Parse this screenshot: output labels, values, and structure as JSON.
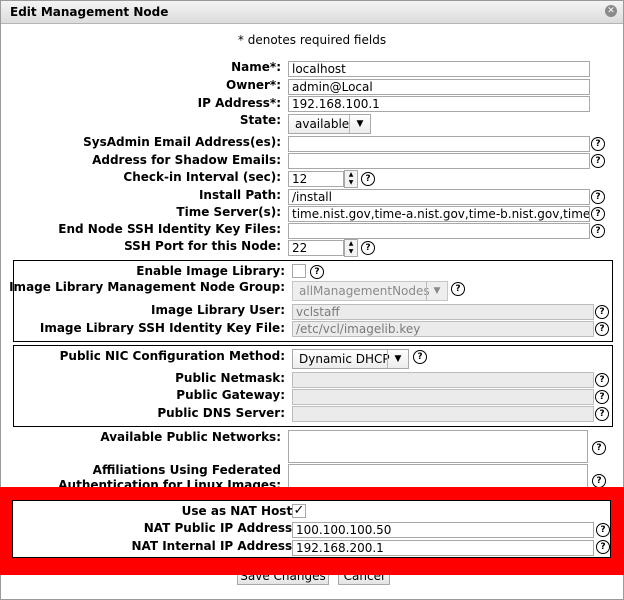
{
  "dialog": {
    "title": "Edit Management Node",
    "required_note": "* denotes required fields"
  },
  "fields": {
    "name": {
      "label": "Name*:",
      "value": "localhost"
    },
    "owner": {
      "label": "Owner*:",
      "value": "admin@Local"
    },
    "ip": {
      "label": "IP Address*:",
      "value": "192.168.100.1"
    },
    "state": {
      "label": "State:",
      "value": "available"
    },
    "sysadmin_email": {
      "label": "SysAdmin Email Address(es):",
      "value": ""
    },
    "shadow_email": {
      "label": "Address for Shadow Emails:",
      "value": ""
    },
    "checkin": {
      "label": "Check-in Interval (sec):",
      "value": "12"
    },
    "install_path": {
      "label": "Install Path:",
      "value": "/install"
    },
    "time_server": {
      "label": "Time Server(s):",
      "value": "time.nist.gov,time-a.nist.gov,time-b.nist.gov,time.win"
    },
    "ssh_key_files": {
      "label": "End Node SSH Identity Key Files:",
      "value": ""
    },
    "ssh_port": {
      "label": "SSH Port for this Node:",
      "value": "22"
    }
  },
  "image_library": {
    "enable_label": "Enable Image Library:",
    "group_label": "Image Library Management Node Group:",
    "group_value": "allManagementNodes",
    "user_label": "Image Library User:",
    "user_value": "vclstaff",
    "key_label": "Image Library SSH Identity Key File:",
    "key_value": "/etc/vcl/imagelib.key"
  },
  "public_nic": {
    "method_label": "Public NIC Configuration Method:",
    "method_value": "Dynamic DHCP",
    "netmask_label": "Public Netmask:",
    "gateway_label": "Public Gateway:",
    "dns_label": "Public DNS Server:"
  },
  "networks": {
    "available_label": "Available Public Networks:",
    "affil_label_1": "Affiliations Using Federated",
    "affil_label_2": "Authentication for Linux Images:"
  },
  "nat": {
    "use_label": "Use as NAT Host:",
    "public_label": "NAT Public IP Address:",
    "public_value": "100.100.100.50",
    "internal_label": "NAT Internal IP Address:",
    "internal_value": "192.168.200.1"
  },
  "buttons": {
    "save": "Save Changes",
    "cancel": "Cancel"
  },
  "glyphs": {
    "help": "?",
    "close": "✕",
    "check": "✓",
    "dropdown": "▼",
    "spin_up": "▲",
    "spin_down": "▼"
  },
  "colors": {
    "highlight": "#ff0000"
  }
}
